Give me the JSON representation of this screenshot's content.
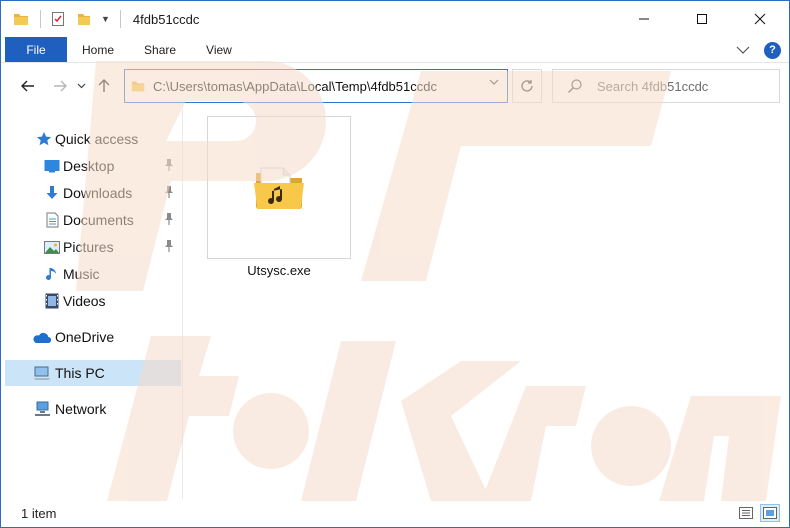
{
  "window": {
    "title": "4fdb51ccdc"
  },
  "ribbon": {
    "tabs": [
      "File",
      "Home",
      "Share",
      "View"
    ]
  },
  "address": {
    "path": "C:\\Users\\tomas\\AppData\\Local\\Temp\\4fdb51ccdc"
  },
  "search": {
    "placeholder": "Search 4fdb51ccdc"
  },
  "navpane": {
    "quick_access": "Quick access",
    "items": [
      {
        "label": "Desktop",
        "icon": "desktop-icon",
        "pinned": true
      },
      {
        "label": "Downloads",
        "icon": "downloads-icon",
        "pinned": true
      },
      {
        "label": "Documents",
        "icon": "documents-icon",
        "pinned": true
      },
      {
        "label": "Pictures",
        "icon": "pictures-icon",
        "pinned": true
      },
      {
        "label": "Music",
        "icon": "music-icon",
        "pinned": false
      },
      {
        "label": "Videos",
        "icon": "videos-icon",
        "pinned": false
      }
    ],
    "onedrive": "OneDrive",
    "this_pc": "This PC",
    "network": "Network"
  },
  "content": {
    "files": [
      {
        "name": "Utsysc.exe",
        "icon": "music-folder-icon"
      }
    ]
  },
  "status": {
    "count": "1 item"
  },
  "colors": {
    "accent": "#1f5fc0",
    "selection": "#cce4f7",
    "watermark": "#f2c7a8"
  }
}
